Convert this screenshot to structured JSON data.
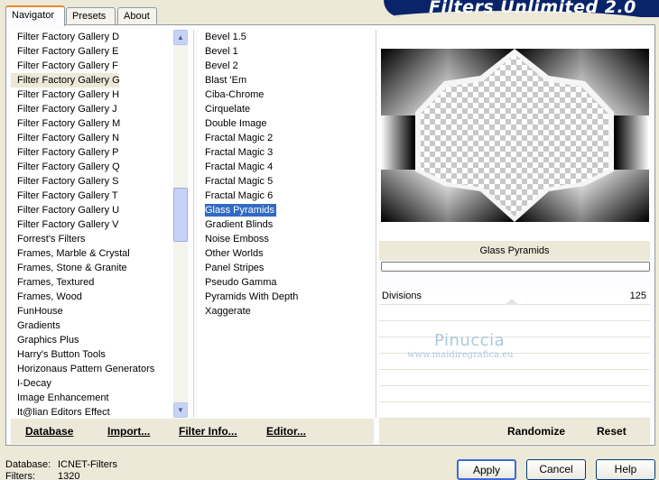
{
  "tabs": [
    {
      "label": "Navigator"
    },
    {
      "label": "Presets"
    },
    {
      "label": "About"
    }
  ],
  "title": "Filters Unlimited 2.0",
  "categories": [
    "Filter Factory Gallery D",
    "Filter Factory Gallery E",
    "Filter Factory Gallery F",
    "Filter Factory Gallery G",
    "Filter Factory Gallery H",
    "Filter Factory Gallery J",
    "Filter Factory Gallery M",
    "Filter Factory Gallery N",
    "Filter Factory Gallery P",
    "Filter Factory Gallery Q",
    "Filter Factory Gallery S",
    "Filter Factory Gallery T",
    "Filter Factory Gallery U",
    "Filter Factory Gallery V",
    "Forrest's Filters",
    "Frames, Marble & Crystal",
    "Frames, Stone & Granite",
    "Frames, Textured",
    "Frames, Wood",
    "FunHouse",
    "Gradients",
    "Graphics Plus",
    "Harry's Button Tools",
    "Horizonaus Pattern Generators",
    "I-Decay",
    "Image Enhancement",
    "It@lian Editors Effect"
  ],
  "selected_category": "Filter Factory Gallery G",
  "filters": [
    "Bevel 1.5",
    "Bevel 1",
    "Bevel 2",
    "Blast 'Em",
    "Ciba-Chrome",
    "Cirquelate",
    "Double Image",
    "Fractal Magic 2",
    "Fractal Magic 3",
    "Fractal Magic 4",
    "Fractal Magic 5",
    "Fractal Magic 6",
    "Glass Pyramids",
    "Gradient Blinds",
    "Noise Emboss",
    "Other Worlds",
    "Panel Stripes",
    "Pseudo Gamma",
    "Pyramids With Depth",
    "Xaggerate"
  ],
  "selected_filter": "Glass Pyramids",
  "preview": {
    "filter_name": "Glass Pyramids"
  },
  "params": [
    {
      "label": "Divisions",
      "value": "125"
    }
  ],
  "watermark": {
    "line1": "Pinuccia",
    "line2": "www.maidiregrafica.eu"
  },
  "toolbar": {
    "database": "Database",
    "import": "Import...",
    "filter_info": "Filter Info...",
    "editor": "Editor...",
    "randomize": "Randomize",
    "reset": "Reset"
  },
  "info": {
    "database_label": "Database:",
    "database_value": "ICNET-Filters",
    "filters_label": "Filters:",
    "filters_value": "1320"
  },
  "buttons": {
    "apply": "Apply",
    "cancel": "Cancel",
    "help": "Help"
  },
  "colors": {
    "selection": "#316ac5",
    "title_banner": "#0a246a",
    "dialog_bg": "#ece9d8"
  }
}
